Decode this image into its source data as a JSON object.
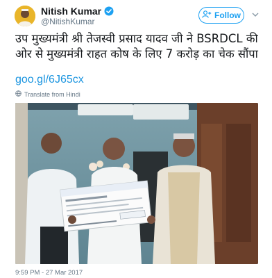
{
  "header": {
    "display_name": "Nitish Kumar",
    "handle": "@NitishKumar",
    "follow_label": "Follow"
  },
  "tweet": {
    "text": "उप मुख्यमंत्री श्री तेजस्वी प्रसाद यादव जी ने BSRDCL की ओर से मुख्यमंत्री राहत कोष के लिए 7 करोड़ का चेक सौंपा",
    "link": "goo.gl/6J65cx",
    "translate_label": "Translate from Hindi",
    "timestamp": "9:59 PM - 27 Mar 2017"
  },
  "colors": {
    "accent": "#1da1f2",
    "link": "#1b95e0",
    "secondary_text": "#657786"
  },
  "icons": {
    "verified": "verified-badge-icon",
    "follow": "add-user-icon",
    "menu": "chevron-down-icon",
    "translate": "globe-icon"
  }
}
